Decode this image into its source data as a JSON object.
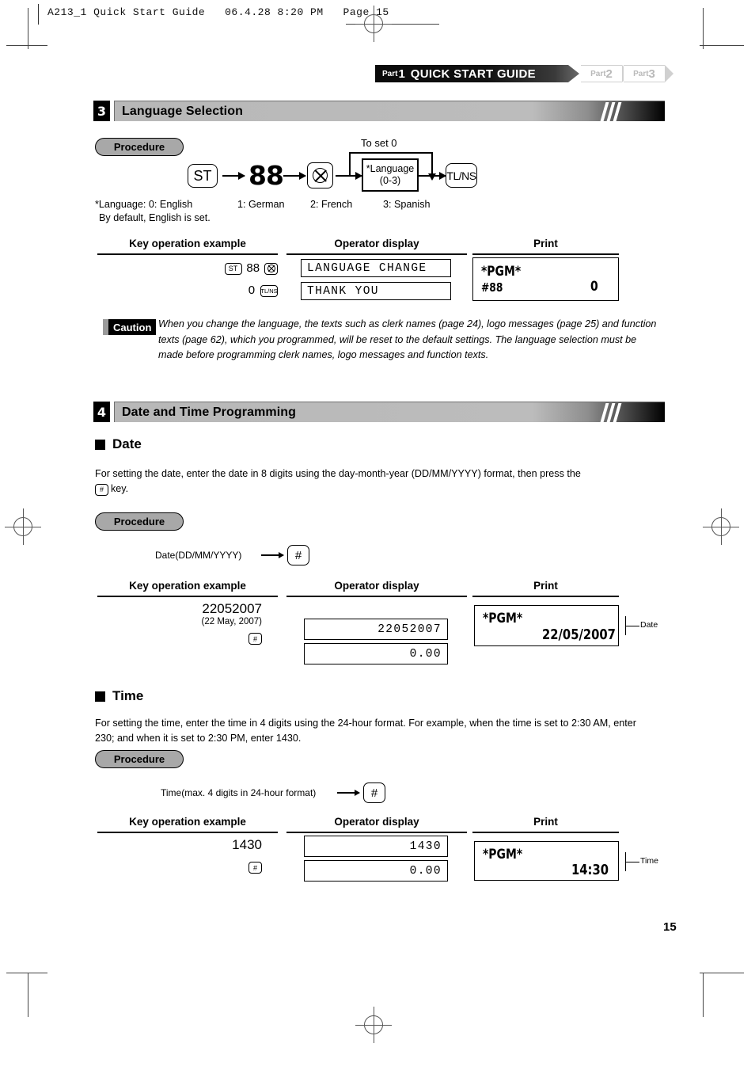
{
  "doc_header": "A213_1 Quick Start Guide   06.4.28 8:20 PM   Page 15",
  "banner": {
    "part1_small": "Part",
    "part1_num": "1",
    "part1_title": "QUICK START GUIDE",
    "part2_small": "Part",
    "part2_num": "2",
    "part3_small": "Part",
    "part3_num": "3"
  },
  "section3": {
    "number": "3",
    "title": "Language Selection",
    "procedure_label": "Procedure",
    "flow": {
      "key_st": "ST",
      "value_88": "88",
      "key_multiply": "multiply-icon",
      "to_set_label": "To set  0",
      "lang_box_line1": "*Language",
      "lang_box_line2": "(0-3)",
      "key_tlns": "TL/NS"
    },
    "footnote_line1": "*Language: 0: English",
    "footnote_opt1": "1: German",
    "footnote_opt2": "2: French",
    "footnote_opt3": "3: Spanish",
    "footnote_line2": "By default, English is set.",
    "table": {
      "col1": "Key operation example",
      "col2": "Operator display",
      "col3": "Print",
      "keyop_row1_st": "ST",
      "keyop_row1_num": "88",
      "keyop_row2_num": "0",
      "keyop_row2_tlns": "TL/NS",
      "display_row1": "LANGUAGE CHANGE",
      "display_row2": "THANK YOU",
      "print_line1": "*PGM*",
      "print_line2_left": "#88",
      "print_line2_right": "0"
    },
    "caution_label": "Caution",
    "caution_text": "When you change the language, the texts such as clerk names (page 24), logo messages (page 25) and function texts (page 62), which you programmed, will be reset to the default settings.  The language selection must be made before programming clerk names, logo messages and function texts."
  },
  "section4": {
    "number": "4",
    "title": "Date and Time Programming",
    "date": {
      "heading": "Date",
      "body": "For setting the date, enter the date in 8 digits using the day-month-year (DD/MM/YYYY) format, then press the",
      "body_key": "#",
      "body_tail": "key.",
      "procedure_label": "Procedure",
      "flow_label": "Date(DD/MM/YYYY)",
      "flow_key": "#",
      "table": {
        "col1": "Key operation example",
        "col2": "Operator display",
        "col3": "Print",
        "keyop_value": "22052007",
        "keyop_note": "(22 May, 2007)",
        "keyop_key": "#",
        "display_row1": "22052007",
        "display_row2": "0.00",
        "print_line1": "*PGM*",
        "print_line2": "22/05/2007",
        "leader_label": "Date"
      }
    },
    "time": {
      "heading": "Time",
      "body_line1": "For setting the time, enter the time in 4 digits using the 24-hour format.  For example, when the time is set to",
      "body_line2": "2:30 AM, enter 230; and when it is set to 2:30 PM, enter 1430.",
      "procedure_label": "Procedure",
      "flow_label": "Time(max. 4 digits in 24-hour format)",
      "flow_key": "#",
      "table": {
        "col1": "Key operation example",
        "col2": "Operator display",
        "col3": "Print",
        "keyop_value": "1430",
        "keyop_key": "#",
        "display_row1": "1430",
        "display_row2": "0.00",
        "print_line1": "*PGM*",
        "print_line2": "14:30",
        "leader_label": "Time"
      }
    }
  },
  "page_number": "15"
}
